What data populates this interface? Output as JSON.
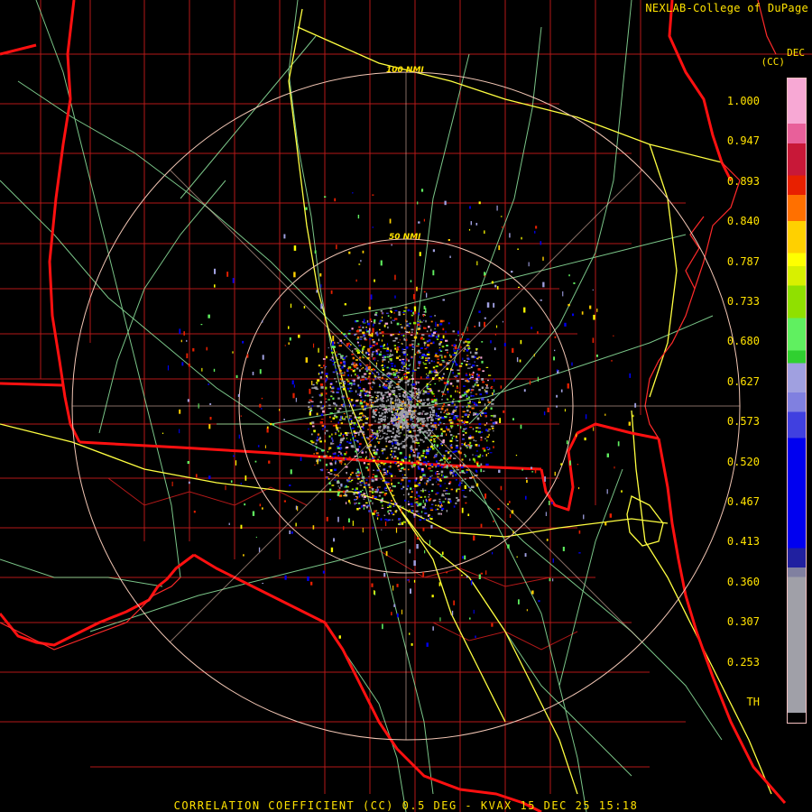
{
  "header": {
    "credit": "NEXLAB-College of DuPage",
    "month_tag": "DEC",
    "units_tag": "(CC)"
  },
  "footer": {
    "caption": "CORRELATION COEFFICIENT (CC) 0.5 DEG - KVAX 15 DEC 25 15:18"
  },
  "range_rings": [
    {
      "label": "50 NMI",
      "range_nmi": 50
    },
    {
      "label": "100 NMI",
      "range_nmi": 100
    }
  ],
  "color_scale": {
    "labels": [
      "1.000",
      "0.947",
      "0.893",
      "0.840",
      "0.787",
      "0.733",
      "0.680",
      "0.627",
      "0.573",
      "0.520",
      "0.467",
      "0.413",
      "0.360",
      "0.307",
      "0.253",
      "TH"
    ],
    "bands": [
      {
        "color": "#f7a8d4",
        "h": 1.4
      },
      {
        "color": "#e8609a",
        "h": 0.6
      },
      {
        "color": "#c81838",
        "h": 1.0
      },
      {
        "color": "#e82000",
        "h": 0.6
      },
      {
        "color": "#ff7000",
        "h": 0.8
      },
      {
        "color": "#ffd000",
        "h": 1.0
      },
      {
        "color": "#ffff00",
        "h": 0.4
      },
      {
        "color": "#d8f000",
        "h": 0.6
      },
      {
        "color": "#90e000",
        "h": 1.0
      },
      {
        "color": "#60f060",
        "h": 1.0
      },
      {
        "color": "#30d030",
        "h": 0.4
      },
      {
        "color": "#a0a0e0",
        "h": 0.9
      },
      {
        "color": "#8080e0",
        "h": 0.6
      },
      {
        "color": "#4040e0",
        "h": 0.8
      },
      {
        "color": "#0000f0",
        "h": 3.4
      },
      {
        "color": "#2020a0",
        "h": 0.6
      },
      {
        "color": "#8080a0",
        "h": 0.3
      },
      {
        "color": "#a0a0a8",
        "h": 4.2
      },
      {
        "color": "#000000",
        "h": 0.3
      }
    ]
  },
  "legend_colors": {
    "state_border": "#ff1010",
    "county_border": "#c81c1c",
    "highway": "#ffff40",
    "road": "#90e8a0",
    "range_ring": "#f2c6b4",
    "text": "#ffe200"
  },
  "radar_site": "KVAX"
}
